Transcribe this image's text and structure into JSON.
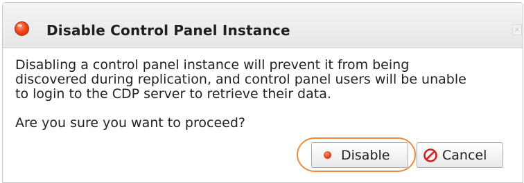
{
  "dialog": {
    "title": "Disable Control Panel Instance",
    "close_label": "×",
    "message": "Disabling a control panel instance will prevent it from being\ndiscovered during replication, and control panel users will be unable\nto login to the CDP server to retrieve their data.",
    "question": "Are you sure you want to proceed?",
    "buttons": {
      "disable_label": "Disable",
      "cancel_label": "Cancel"
    },
    "icons": {
      "title": "red-circle-icon",
      "disable": "red-dot-icon",
      "cancel": "no-entry-icon"
    },
    "colors": {
      "title_icon": "#f0461d",
      "cancel_icon": "#d21f1f",
      "highlight": "#ee8a3b"
    }
  }
}
